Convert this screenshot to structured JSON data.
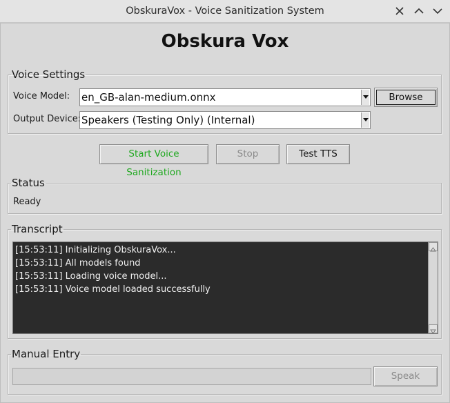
{
  "window": {
    "title": "ObskuraVox - Voice Sanitization System"
  },
  "app": {
    "heading": "Obskura Vox"
  },
  "voice_settings": {
    "legend": "Voice Settings",
    "voice_model_label": "Voice Model:",
    "voice_model_value": "en_GB-alan-medium.onnx",
    "browse_label": "Browse",
    "output_device_label": "Output Device:",
    "output_device_value": "Speakers (Testing Only) (Internal)"
  },
  "controls": {
    "start_label": "Start Voice Sanitization",
    "stop_label": "Stop",
    "test_label": "Test TTS"
  },
  "status": {
    "legend": "Status",
    "text": "Ready"
  },
  "transcript": {
    "legend": "Transcript",
    "lines": [
      "[15:53:11] Initializing ObskuraVox...",
      "[15:53:11] All models found",
      "[15:53:11] Loading voice model...",
      "[15:53:11] Voice model loaded successfully"
    ]
  },
  "manual_entry": {
    "legend": "Manual Entry",
    "input_value": "",
    "speak_label": "Speak"
  },
  "colors": {
    "start_text": "#1fa81f",
    "transcript_bg": "#2b2b2b"
  },
  "icons": [
    "close-icon",
    "chevron-up-icon",
    "chevron-down-icon",
    "dropdown-arrow-icon"
  ]
}
